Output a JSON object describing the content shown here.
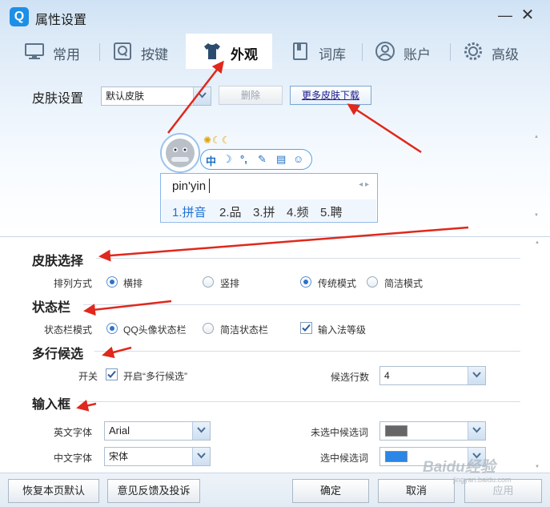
{
  "window": {
    "title": "属性设置",
    "logo": "Q",
    "minimize_glyph": "—",
    "close_glyph": "✕"
  },
  "tabs": [
    {
      "label": "常用",
      "icon": "monitor-icon"
    },
    {
      "label": "按键",
      "icon": "q-key-icon"
    },
    {
      "label": "外观",
      "icon": "tshirt-icon",
      "active": true
    },
    {
      "label": "词库",
      "icon": "book-icon"
    },
    {
      "label": "账户",
      "icon": "user-icon"
    },
    {
      "label": "高级",
      "icon": "gear-icon"
    }
  ],
  "skin": {
    "label": "皮肤设置",
    "selected": "默认皮肤",
    "delete_label": "删除",
    "more_label": "更多皮肤下载"
  },
  "preview": {
    "weather": "✺☾☾",
    "status_items": [
      "中",
      "☽",
      "°,",
      "✎",
      "▤",
      "☺"
    ],
    "input_text": "pin'yin",
    "nav": "◂ ▸",
    "candidates": [
      "1.拼音",
      "2.品",
      "3.拼",
      "4.频",
      "5.聘"
    ]
  },
  "sections": {
    "skin_select": {
      "title": "皮肤选择",
      "label": "排列方式",
      "options": [
        "横排",
        "竖排",
        "传统模式",
        "简洁模式"
      ],
      "selected": [
        "横排",
        "传统模式"
      ]
    },
    "status_bar": {
      "title": "状态栏",
      "label": "状态栏模式",
      "options": [
        "QQ头像状态栏",
        "简洁状态栏"
      ],
      "selected": "QQ头像状态栏",
      "checkbox": "输入法等级",
      "checkbox_checked": true
    },
    "multi_candidate": {
      "title": "多行候选",
      "label": "开关",
      "checkbox": "开启“多行候选”",
      "checkbox_checked": true,
      "rows_label": "候选行数",
      "rows_value": "4"
    },
    "input_box": {
      "title": "输入框",
      "en_font_label": "英文字体",
      "en_font_value": "Arial",
      "cn_font_label": "中文字体",
      "cn_font_value": "宋体",
      "unselected_label": "未选中候选词",
      "unselected_color": "#666666",
      "selected_label": "选中候选词",
      "selected_color": "#2b86e6"
    }
  },
  "footer": {
    "restore": "恢复本页默认",
    "feedback": "意见反馈及投诉",
    "ok": "确定",
    "cancel": "取消",
    "apply": "应用"
  },
  "watermark": {
    "text": "Baidu经验",
    "sub": "jingyan.baidu.com"
  },
  "colors": {
    "accent": "#1d8fe6",
    "annotation": "#e0281c"
  }
}
